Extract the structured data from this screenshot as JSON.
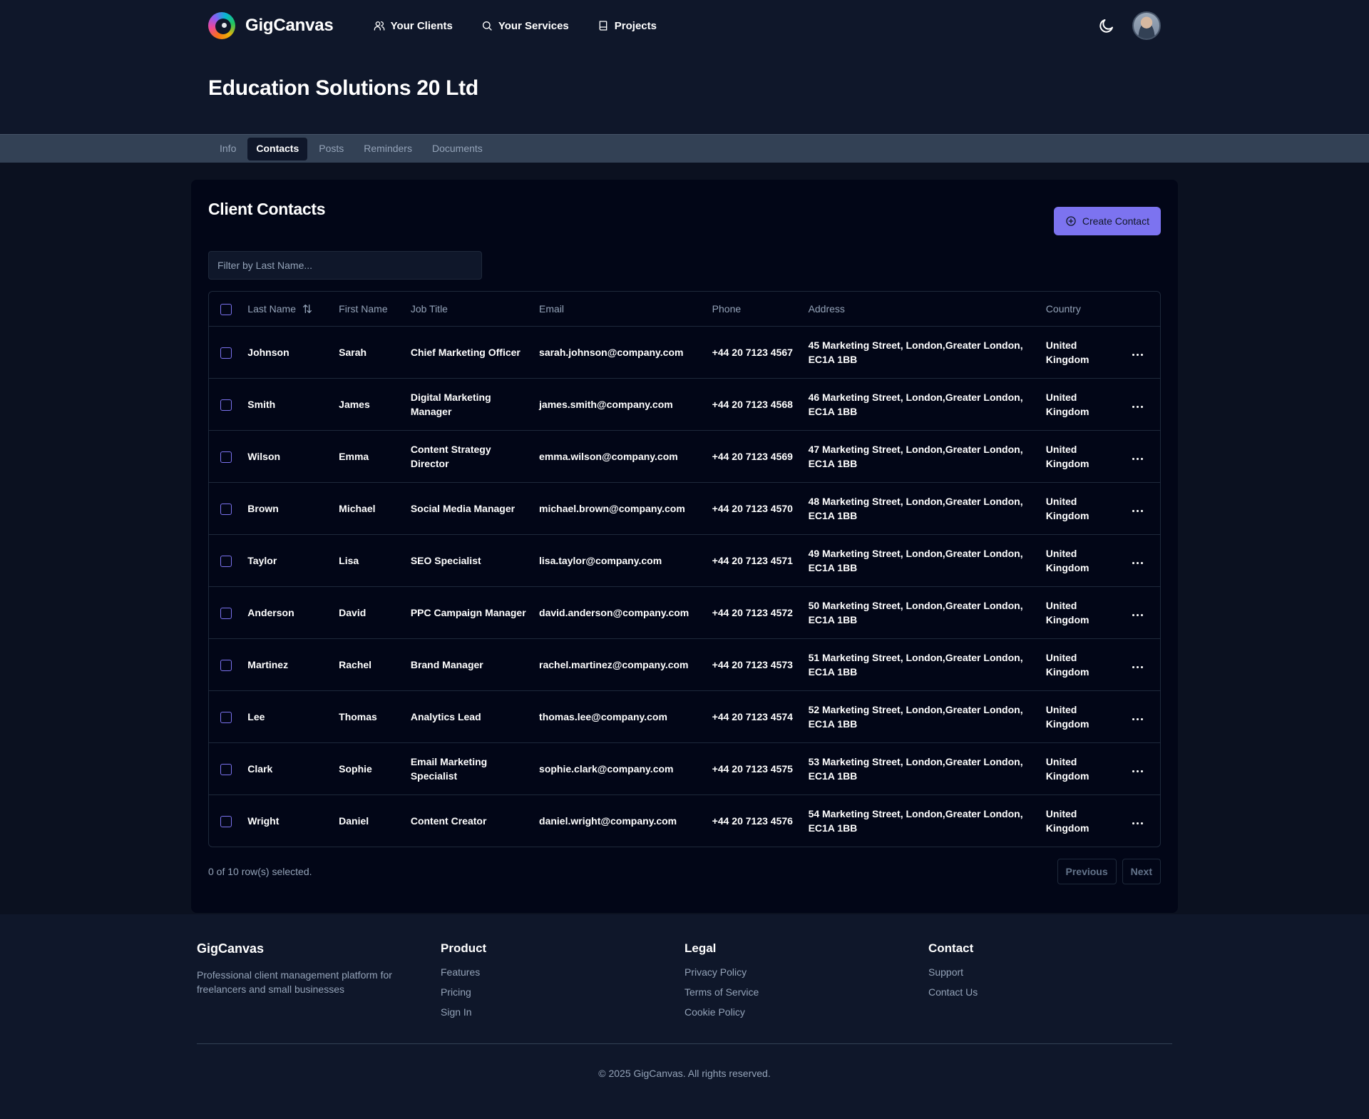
{
  "app": {
    "brand": "GigCanvas",
    "nav": [
      {
        "label": "Your Clients",
        "icon": "users-icon"
      },
      {
        "label": "Your Services",
        "icon": "search-icon"
      },
      {
        "label": "Projects",
        "icon": "book-icon"
      }
    ]
  },
  "page": {
    "title": "Education Solutions 20 Ltd",
    "tabs": [
      "Info",
      "Contacts",
      "Posts",
      "Reminders",
      "Documents"
    ],
    "active_tab": "Contacts"
  },
  "contacts": {
    "title": "Client Contacts",
    "create_label": "Create Contact",
    "filter_placeholder": "Filter by Last Name...",
    "columns": [
      "Last Name",
      "First Name",
      "Job Title",
      "Email",
      "Phone",
      "Address",
      "Country"
    ],
    "rows": [
      {
        "last": "Johnson",
        "first": "Sarah",
        "job": "Chief Marketing Officer",
        "email": "sarah.johnson@company.com",
        "phone": "+44 20 7123 4567",
        "address": "45 Marketing Street, London,Greater London, EC1A 1BB",
        "country": "United Kingdom"
      },
      {
        "last": "Smith",
        "first": "James",
        "job": "Digital Marketing Manager",
        "email": "james.smith@company.com",
        "phone": "+44 20 7123 4568",
        "address": "46 Marketing Street, London,Greater London, EC1A 1BB",
        "country": "United Kingdom"
      },
      {
        "last": "Wilson",
        "first": "Emma",
        "job": "Content Strategy Director",
        "email": "emma.wilson@company.com",
        "phone": "+44 20 7123 4569",
        "address": "47 Marketing Street, London,Greater London, EC1A 1BB",
        "country": "United Kingdom"
      },
      {
        "last": "Brown",
        "first": "Michael",
        "job": "Social Media Manager",
        "email": "michael.brown@company.com",
        "phone": "+44 20 7123 4570",
        "address": "48 Marketing Street, London,Greater London, EC1A 1BB",
        "country": "United Kingdom"
      },
      {
        "last": "Taylor",
        "first": "Lisa",
        "job": "SEO Specialist",
        "email": "lisa.taylor@company.com",
        "phone": "+44 20 7123 4571",
        "address": "49 Marketing Street, London,Greater London, EC1A 1BB",
        "country": "United Kingdom"
      },
      {
        "last": "Anderson",
        "first": "David",
        "job": "PPC Campaign Manager",
        "email": "david.anderson@company.com",
        "phone": "+44 20 7123 4572",
        "address": "50 Marketing Street, London,Greater London, EC1A 1BB",
        "country": "United Kingdom"
      },
      {
        "last": "Martinez",
        "first": "Rachel",
        "job": "Brand Manager",
        "email": "rachel.martinez@company.com",
        "phone": "+44 20 7123 4573",
        "address": "51 Marketing Street, London,Greater London, EC1A 1BB",
        "country": "United Kingdom"
      },
      {
        "last": "Lee",
        "first": "Thomas",
        "job": "Analytics Lead",
        "email": "thomas.lee@company.com",
        "phone": "+44 20 7123 4574",
        "address": "52 Marketing Street, London,Greater London, EC1A 1BB",
        "country": "United Kingdom"
      },
      {
        "last": "Clark",
        "first": "Sophie",
        "job": "Email Marketing Specialist",
        "email": "sophie.clark@company.com",
        "phone": "+44 20 7123 4575",
        "address": "53 Marketing Street, London,Greater London, EC1A 1BB",
        "country": "United Kingdom"
      },
      {
        "last": "Wright",
        "first": "Daniel",
        "job": "Content Creator",
        "email": "daniel.wright@company.com",
        "phone": "+44 20 7123 4576",
        "address": "54 Marketing Street, London,Greater London, EC1A 1BB",
        "country": "United Kingdom"
      }
    ],
    "selection_text": "0 of 10 row(s) selected.",
    "previous_label": "Previous",
    "next_label": "Next"
  },
  "footer": {
    "brand": "GigCanvas",
    "description": "Professional client management platform for freelancers and small businesses",
    "columns": [
      {
        "heading": "Product",
        "links": [
          "Features",
          "Pricing",
          "Sign In"
        ]
      },
      {
        "heading": "Legal",
        "links": [
          "Privacy Policy",
          "Terms of Service",
          "Cookie Policy"
        ]
      },
      {
        "heading": "Contact",
        "links": [
          "Support",
          "Contact Us"
        ]
      }
    ],
    "copyright": "© 2025 GigCanvas. All rights reserved."
  },
  "colors": {
    "background": "#0f172a",
    "card": "#020617",
    "tabs_bar": "#334155",
    "accent": "#7c73f0"
  }
}
